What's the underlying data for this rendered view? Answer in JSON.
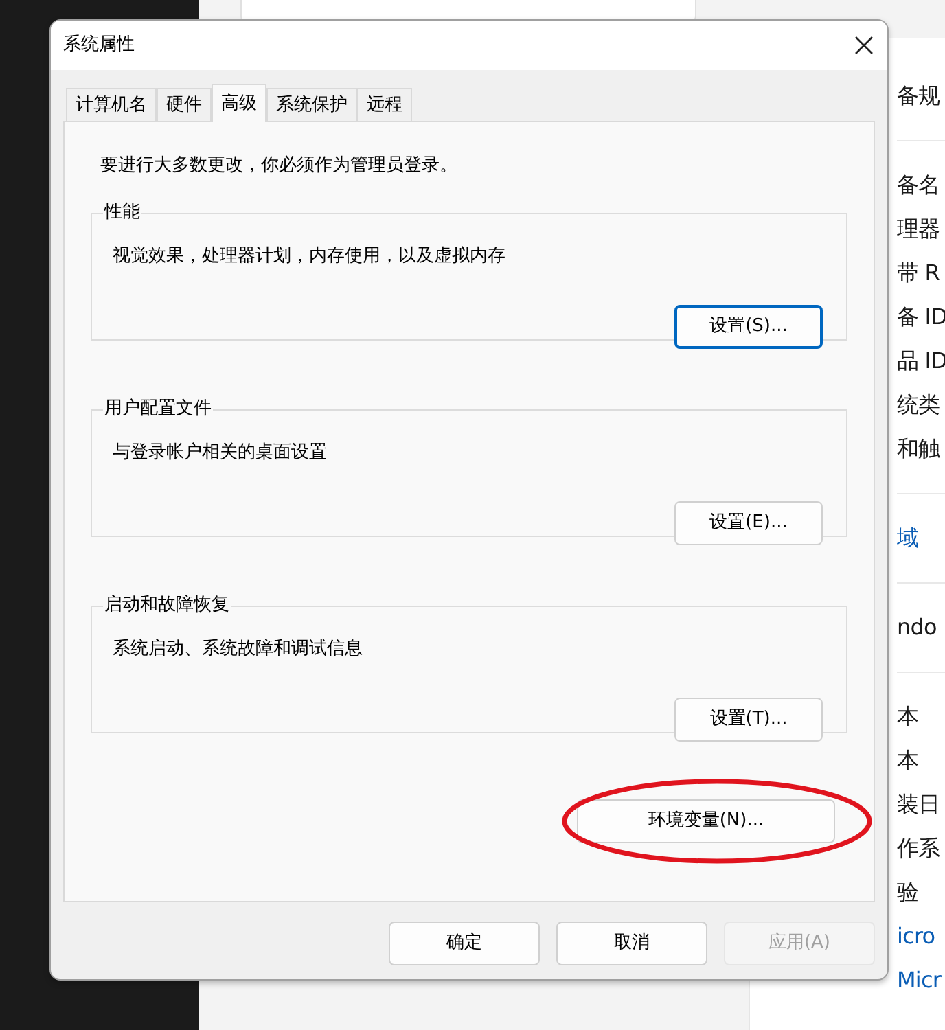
{
  "background": {
    "side_groups": [
      {
        "items": [
          {
            "text": "备规",
            "kind": "text"
          }
        ]
      },
      {
        "items": [
          {
            "text": "备名",
            "kind": "text"
          },
          {
            "text": "理器",
            "kind": "text"
          },
          {
            "text": "带 R",
            "kind": "text"
          },
          {
            "text": "备 ID",
            "kind": "text"
          },
          {
            "text": "品 ID",
            "kind": "text"
          },
          {
            "text": "统类",
            "kind": "text"
          },
          {
            "text": "和触",
            "kind": "text"
          }
        ]
      },
      {
        "items": [
          {
            "text": "域",
            "kind": "link"
          }
        ]
      },
      {
        "items": [
          {
            "text": "ndo",
            "kind": "text"
          }
        ]
      },
      {
        "items": [
          {
            "text": "本",
            "kind": "text"
          },
          {
            "text": "本",
            "kind": "text"
          },
          {
            "text": "装日",
            "kind": "text"
          },
          {
            "text": "作系",
            "kind": "text"
          },
          {
            "text": "验",
            "kind": "text"
          },
          {
            "text": "icro",
            "kind": "link"
          },
          {
            "text": "Micr",
            "kind": "link"
          }
        ]
      }
    ]
  },
  "window": {
    "title": "系统属性"
  },
  "tabs": [
    {
      "label": "计算机名",
      "selected": false
    },
    {
      "label": "硬件",
      "selected": false
    },
    {
      "label": "高级",
      "selected": true
    },
    {
      "label": "系统保护",
      "selected": false
    },
    {
      "label": "远程",
      "selected": false
    }
  ],
  "notice": "要进行大多数更改，你必须作为管理员登录。",
  "groups": [
    {
      "title": "性能",
      "description": "视觉效果，处理器计划，内存使用，以及虚拟内存",
      "button": {
        "label": "设置(S)...",
        "focused": true
      }
    },
    {
      "title": "用户配置文件",
      "description": "与登录帐户相关的桌面设置",
      "button": {
        "label": "设置(E)...",
        "focused": false
      }
    },
    {
      "title": "启动和故障恢复",
      "description": "系统启动、系统故障和调试信息",
      "button": {
        "label": "设置(T)...",
        "focused": false
      }
    }
  ],
  "env_button": {
    "label": "环境变量(N)...",
    "circled": true
  },
  "buttons": [
    {
      "label": "确定",
      "disabled": false
    },
    {
      "label": "取消",
      "disabled": false
    },
    {
      "label": "应用(A)",
      "disabled": true
    }
  ]
}
